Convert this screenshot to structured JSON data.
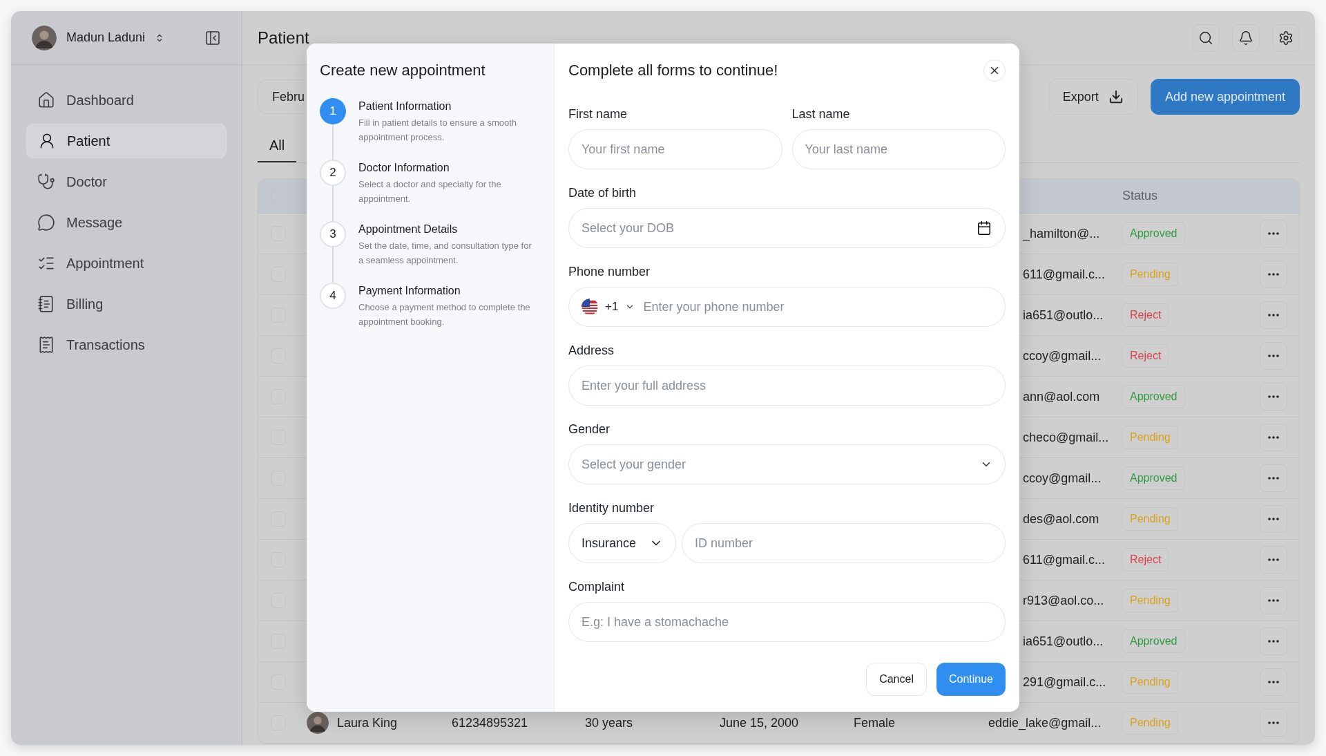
{
  "user": {
    "name": "Madun Laduni"
  },
  "nav": [
    {
      "label": "Dashboard",
      "selected": false
    },
    {
      "label": "Patient",
      "selected": true
    },
    {
      "label": "Doctor",
      "selected": false
    },
    {
      "label": "Message",
      "selected": false
    },
    {
      "label": "Appointment",
      "selected": false
    },
    {
      "label": "Billing",
      "selected": false
    },
    {
      "label": "Transactions",
      "selected": false
    }
  ],
  "page_title": "Patient",
  "toolbar": {
    "date_filter": "Febru",
    "export": "Export",
    "add": "Add new appointment"
  },
  "tabs": [
    {
      "label": "All",
      "selected": true
    }
  ],
  "table": {
    "status_header": "Status",
    "select_all_checked": false,
    "rows": [
      {
        "email": "_hamilton@...",
        "status": "Approved",
        "color": "#2e9a3e",
        "checked": false
      },
      {
        "email": "611@gmail.c...",
        "status": "Pending",
        "color": "#d9a21b",
        "checked": false
      },
      {
        "email": "ia651@outlo...",
        "status": "Reject",
        "color": "#d9424a",
        "checked": false
      },
      {
        "email": "ccoy@gmail...",
        "status": "Reject",
        "color": "#d9424a",
        "checked": false
      },
      {
        "email": "ann@aol.com",
        "status": "Approved",
        "color": "#2e9a3e",
        "checked": false
      },
      {
        "email": "checo@gmail...",
        "status": "Pending",
        "color": "#d9a21b",
        "checked": false
      },
      {
        "email": "ccoy@gmail...",
        "status": "Approved",
        "color": "#2e9a3e",
        "checked": false
      },
      {
        "email": "des@aol.com",
        "status": "Pending",
        "color": "#d9a21b",
        "checked": false
      },
      {
        "email": "611@gmail.c...",
        "status": "Reject",
        "color": "#d9424a",
        "checked": false
      },
      {
        "email": "r913@aol.co...",
        "status": "Pending",
        "color": "#d9a21b",
        "checked": false
      },
      {
        "email": "ia651@outlo...",
        "status": "Approved",
        "color": "#2e9a3e",
        "checked": false
      },
      {
        "email": "291@gmail.c...",
        "status": "Pending",
        "color": "#d9a21b",
        "checked": false
      },
      {
        "name": "Laura King",
        "id": "61234895321",
        "age": "30 years",
        "dob": "June 15, 2000",
        "gender": "Female",
        "email": "eddie_lake@gmail...",
        "status": "Pending",
        "color": "#d9a21b",
        "checked": false
      }
    ]
  },
  "modal": {
    "title": "Create new appointment",
    "steps": [
      {
        "number": "1",
        "title": "Patient Information",
        "description": "Fill in patient details to ensure a smooth appointment process.",
        "selected": true
      },
      {
        "number": "2",
        "title": "Doctor Information",
        "description": "Select a doctor and specialty for the appointment.",
        "selected": false
      },
      {
        "number": "3",
        "title": "Appointment Details",
        "description": "Set the date, time, and consultation type for a seamless appointment.",
        "selected": false
      },
      {
        "number": "4",
        "title": "Payment Information",
        "description": "Choose a payment method to complete the appointment booking.",
        "selected": false
      }
    ],
    "form_title": "Complete all forms to continue!",
    "first_name": {
      "label": "First name",
      "placeholder": "Your first name"
    },
    "last_name": {
      "label": "Last name",
      "placeholder": "Your last name"
    },
    "dob": {
      "label": "Date of birth",
      "placeholder": "Select your DOB"
    },
    "phone": {
      "label": "Phone number",
      "country_code": "+1",
      "placeholder": "Enter your phone number"
    },
    "address": {
      "label": "Address",
      "placeholder": "Enter your full address"
    },
    "gender": {
      "label": "Gender",
      "placeholder": "Select your gender"
    },
    "identity": {
      "label": "Identity number",
      "type": "Insurance",
      "placeholder": "ID number"
    },
    "complaint": {
      "label": "Complaint",
      "placeholder": "E.g: I have a stomachache"
    },
    "cancel": "Cancel",
    "continue": "Continue"
  }
}
